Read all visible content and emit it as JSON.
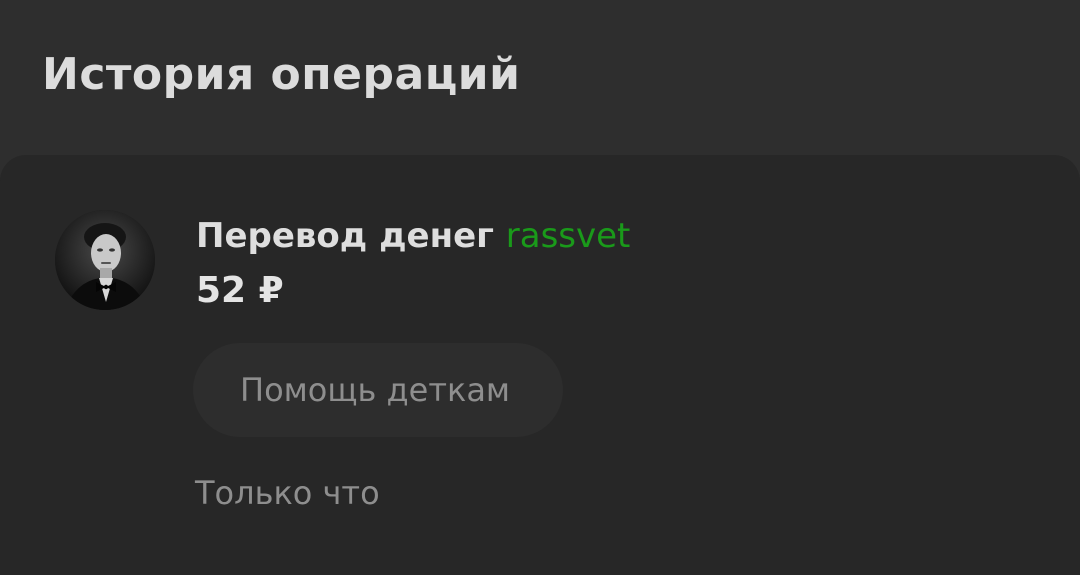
{
  "header": {
    "title": "История операций"
  },
  "operation": {
    "avatar_icon": "user-photo-avatar",
    "title_prefix": "Перевод денег",
    "recipient": "rassvet",
    "amount": "52 ₽",
    "comment": "Помощь деткам",
    "time": "Только что"
  },
  "colors": {
    "background": "#2e2e2e",
    "card": "#272727",
    "recipient_accent": "#1a9a1a"
  }
}
